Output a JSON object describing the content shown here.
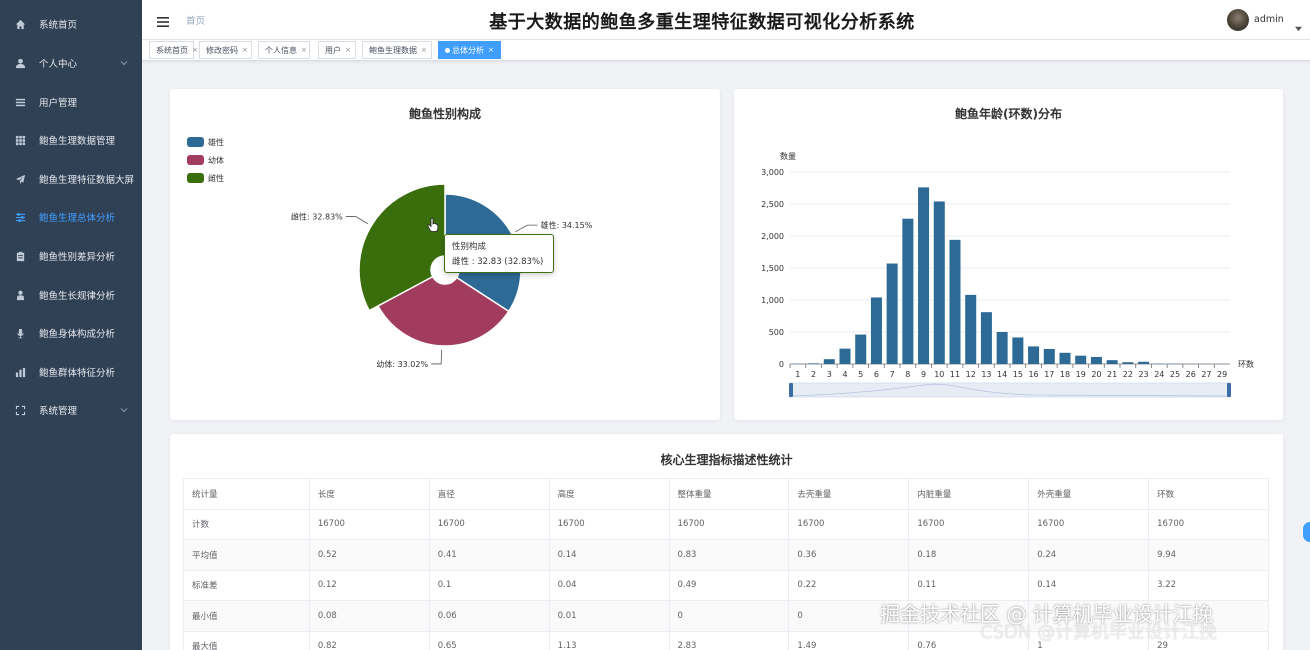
{
  "app": {
    "title": "基于大数据的鲍鱼多重生理特征数据可视化分析系统",
    "breadcrumb": "首页",
    "user": "admin"
  },
  "sidebar": {
    "items": [
      {
        "label": "系统首页",
        "icon": "home-icon"
      },
      {
        "label": "个人中心",
        "icon": "user-icon",
        "expandable": true
      },
      {
        "label": "用户管理",
        "icon": "list-icon"
      },
      {
        "label": "鲍鱼生理数据管理",
        "icon": "grid-icon"
      },
      {
        "label": "鲍鱼生理特征数据大屏",
        "icon": "send-icon"
      },
      {
        "label": "鲍鱼生理总体分析",
        "icon": "sliders-icon",
        "active": true
      },
      {
        "label": "鲍鱼性别差异分析",
        "icon": "clipboard-icon"
      },
      {
        "label": "鲍鱼生长规律分析",
        "icon": "person-icon"
      },
      {
        "label": "鲍鱼身体构成分析",
        "icon": "mic-icon"
      },
      {
        "label": "鲍鱼群体特征分析",
        "icon": "bar-icon"
      },
      {
        "label": "系统管理",
        "icon": "fullscreen-icon",
        "expandable": true
      }
    ]
  },
  "tags": [
    {
      "label": "系统首页"
    },
    {
      "label": "修改密码"
    },
    {
      "label": "个人信息"
    },
    {
      "label": "用户"
    },
    {
      "label": "鲍鱼生理数据"
    },
    {
      "label": "总体分析",
      "active": true
    }
  ],
  "colors": {
    "sidebar_bg": "#304156",
    "active": "#409eff",
    "male": "#2e6a96",
    "juvenile": "#a13c5e",
    "female": "#3a6e0d",
    "bar": "#2e6a96"
  },
  "chart_data": [
    {
      "type": "pie",
      "title": "鲍鱼性别构成",
      "legend": [
        "雄性",
        "幼体",
        "雌性"
      ],
      "slices": [
        {
          "name": "雄性",
          "value": 34.15,
          "label": "雄性: 34.15%"
        },
        {
          "name": "幼体",
          "value": 33.02,
          "label": "幼体: 33.02%"
        },
        {
          "name": "雌性",
          "value": 32.83,
          "label": "雌性: 32.83%"
        }
      ],
      "tooltip": {
        "title": "性别构成",
        "text": "雌性 : 32.83 (32.83%)"
      }
    },
    {
      "type": "bar",
      "title": "鲍鱼年龄(环数)分布",
      "xlabel": "环数",
      "ylabel": "数量",
      "ylim": [
        0,
        3000
      ],
      "yticks": [
        "0",
        "500",
        "1,000",
        "1,500",
        "2,000",
        "2,500",
        "3,000"
      ],
      "categories": [
        "1",
        "2",
        "3",
        "4",
        "5",
        "6",
        "7",
        "8",
        "9",
        "10",
        "11",
        "12",
        "13",
        "14",
        "15",
        "16",
        "17",
        "18",
        "19",
        "20",
        "21",
        "22",
        "23",
        "24",
        "25",
        "26",
        "27",
        "29"
      ],
      "values": [
        3,
        10,
        75,
        240,
        460,
        1040,
        1570,
        2270,
        2760,
        2540,
        1940,
        1080,
        810,
        500,
        415,
        275,
        235,
        175,
        130,
        110,
        60,
        28,
        35,
        5,
        3,
        2,
        2,
        2
      ]
    }
  ],
  "stats_table": {
    "title": "核心生理指标描述性统计",
    "headers": [
      "统计量",
      "长度",
      "直径",
      "高度",
      "整体重量",
      "去壳重量",
      "内脏重量",
      "外壳重量",
      "环数"
    ],
    "rows": [
      [
        "计数",
        "16700",
        "16700",
        "16700",
        "16700",
        "16700",
        "16700",
        "16700",
        "16700"
      ],
      [
        "平均值",
        "0.52",
        "0.41",
        "0.14",
        "0.83",
        "0.36",
        "0.18",
        "0.24",
        "9.94"
      ],
      [
        "标准差",
        "0.12",
        "0.1",
        "0.04",
        "0.49",
        "0.22",
        "0.11",
        "0.14",
        "3.22"
      ],
      [
        "最小值",
        "0.08",
        "0.06",
        "0.01",
        "0",
        "0",
        "",
        "",
        ""
      ],
      [
        "最大值",
        "0.82",
        "0.65",
        "1.13",
        "2.83",
        "1.49",
        "0.76",
        "1",
        "29"
      ]
    ]
  },
  "watermark": {
    "line1": "掘金技术社区 @ 计算机毕业设计江挽",
    "line2": "CSDN @计算机毕业设计江挽"
  }
}
